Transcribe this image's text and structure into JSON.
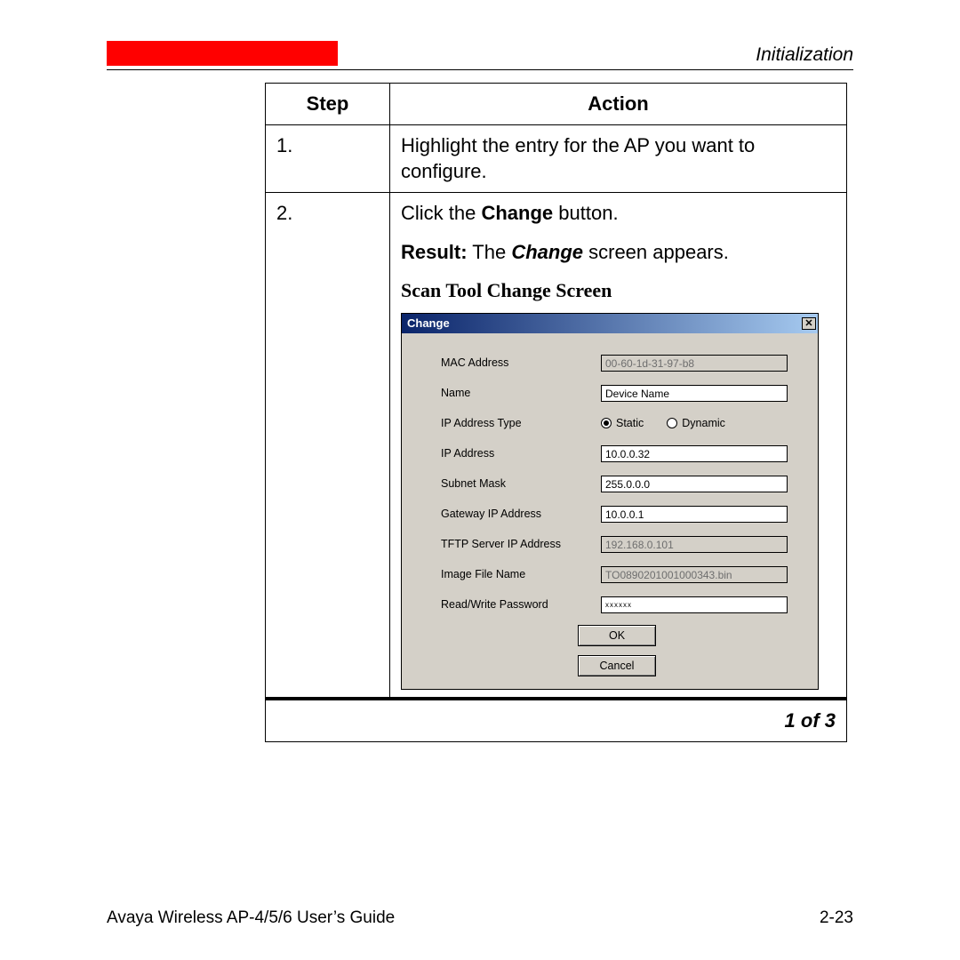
{
  "header": {
    "section": "Initialization"
  },
  "table": {
    "headers": {
      "step": "Step",
      "action": "Action"
    },
    "rows": [
      {
        "num": "1.",
        "action_plain": "Highlight the entry for the AP you want to configure."
      },
      {
        "num": "2.",
        "click_pre": "Click the ",
        "click_bold": "Change",
        "click_post": " button.",
        "result_label": "Result:",
        "result_pre": " The ",
        "result_em": "Change",
        "result_post": " screen appears.",
        "caption": "Scan Tool Change Screen"
      }
    ],
    "page_of": "1 of 3"
  },
  "dialog": {
    "title": "Change",
    "fields": {
      "mac_label": "MAC Address",
      "mac_value": "00-60-1d-31-97-b8",
      "name_label": "Name",
      "name_value": "Device Name",
      "iptype_label": "IP Address Type",
      "static_label": "Static",
      "dynamic_label": "Dynamic",
      "ip_label": "IP Address",
      "ip_value": "10.0.0.32",
      "subnet_label": "Subnet Mask",
      "subnet_value": "255.0.0.0",
      "gw_label": "Gateway IP Address",
      "gw_value": "10.0.0.1",
      "tftp_label": "TFTP Server IP Address",
      "tftp_value": "192.168.0.101",
      "image_label": "Image File Name",
      "image_value": "TO0890201001000343.bin",
      "pw_label": "Read/Write Password",
      "pw_value": "xxxxxx"
    },
    "buttons": {
      "ok": "OK",
      "cancel": "Cancel"
    }
  },
  "footer": {
    "left": "Avaya Wireless AP-4/5/6 User’s Guide",
    "right": "2-23"
  }
}
